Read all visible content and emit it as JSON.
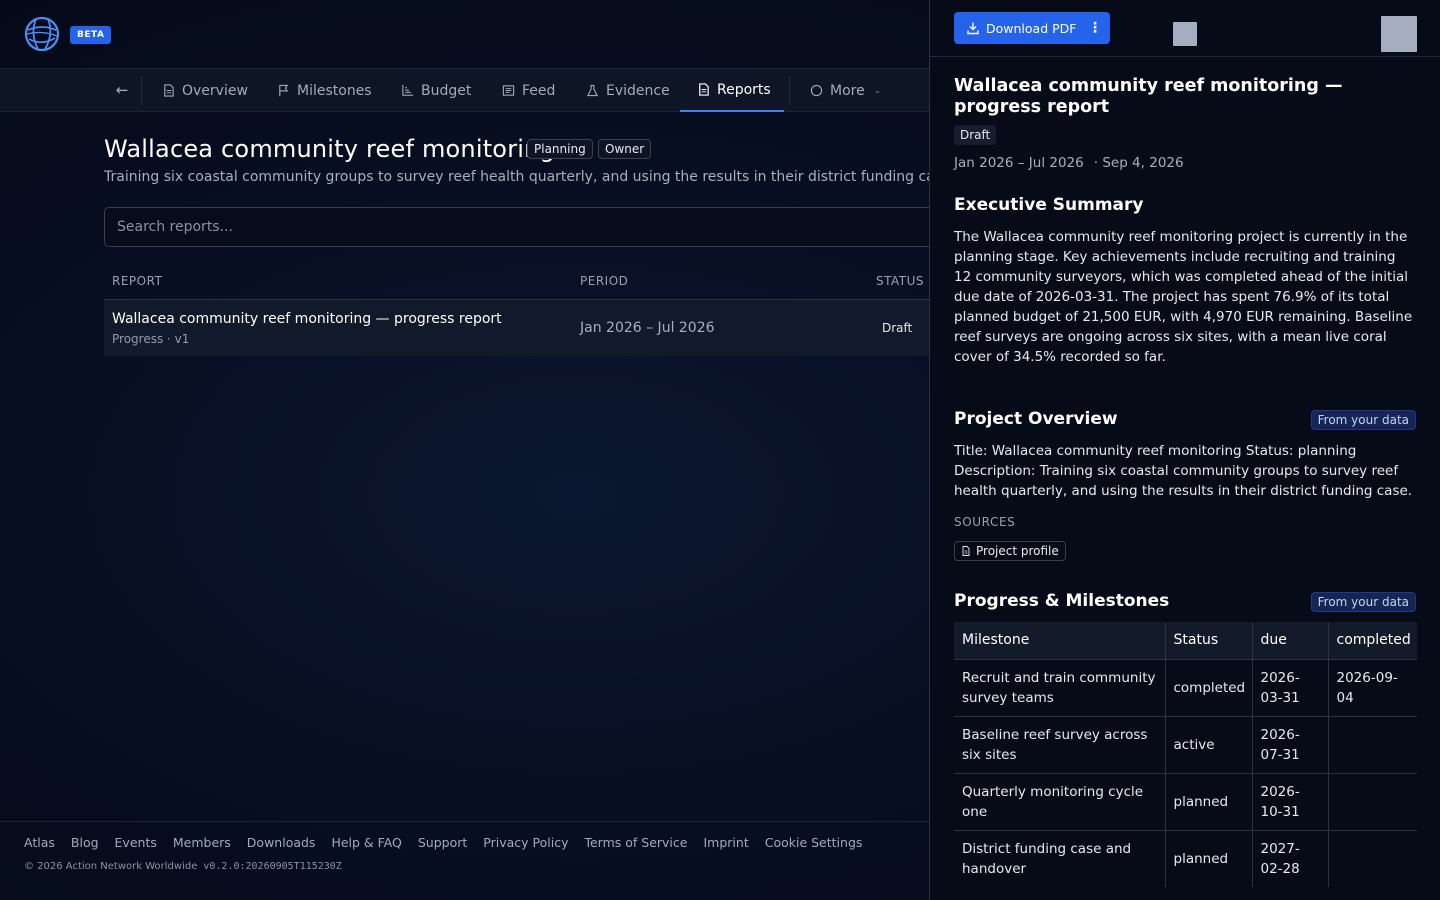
{
  "header": {
    "beta": "BETA"
  },
  "nav": {
    "tabs": [
      {
        "label": "Overview",
        "icon": "doc-icon"
      },
      {
        "label": "Milestones",
        "icon": "flag-icon"
      },
      {
        "label": "Budget",
        "icon": "chart-icon"
      },
      {
        "label": "Feed",
        "icon": "feed-icon"
      },
      {
        "label": "Evidence",
        "icon": "flask-icon"
      },
      {
        "label": "Reports",
        "icon": "report-icon",
        "active": true
      },
      {
        "label": "More",
        "icon": "circle-icon"
      }
    ]
  },
  "project": {
    "title": "Wallacea community reef monitoring",
    "status_chip": "Planning",
    "role_chip": "Owner",
    "description": "Training six coastal community groups to survey reef health quarterly, and using the results in their district funding case."
  },
  "search": {
    "placeholder": "Search reports..."
  },
  "table": {
    "headers": {
      "report": "REPORT",
      "period": "PERIOD",
      "status": "STATUS"
    },
    "rows": [
      {
        "title": "Wallacea community reef monitoring — progress report",
        "sub": "Progress · v1",
        "period": "Jan 2026 – Jul 2026",
        "status": "Draft"
      }
    ]
  },
  "footer": {
    "links": [
      "Atlas",
      "Blog",
      "Events",
      "Members",
      "Downloads",
      "Help & FAQ",
      "Support",
      "Privacy Policy",
      "Terms of Service",
      "Imprint",
      "Cookie Settings"
    ],
    "copyright": "© 2026 Action Network Worldwide",
    "version": "v0.2.0:20260905T115230Z"
  },
  "panel": {
    "download_label": "Download PDF",
    "title": "Wallacea community reef monitoring — progress report",
    "status": "Draft",
    "period": "Jan 2026 – Jul 2026",
    "date": "· Sep 4, 2026",
    "exec": {
      "heading": "Executive Summary",
      "text": "The Wallacea community reef monitoring project is currently in the planning stage. Key achievements include recruiting and training 12 community surveyors, which was completed ahead of the initial due date of 2026-03-31. The project has spent 76.9% of its total planned budget of 21,500 EUR, with 4,970 EUR remaining. Baseline reef surveys are ongoing across six sites, with a mean live coral cover of 34.5% recorded so far."
    },
    "overview": {
      "heading": "Project Overview",
      "badge": "From your data",
      "text": "Title: Wallacea community reef monitoring Status: planning Description: Training six coastal community groups to survey reef health quarterly, and using the results in their district funding case.",
      "sources_label": "SOURCES",
      "source": "Project profile"
    },
    "milestones": {
      "heading": "Progress & Milestones",
      "badge": "From your data",
      "columns": [
        "Milestone",
        "Status",
        "due",
        "completed"
      ],
      "rows": [
        {
          "milestone": "Recruit and train community survey teams",
          "status": "completed",
          "due": "2026-03-31",
          "completed": "2026-09-04"
        },
        {
          "milestone": "Baseline reef survey across six sites",
          "status": "active",
          "due": "2026-07-31",
          "completed": ""
        },
        {
          "milestone": "Quarterly monitoring cycle one",
          "status": "planned",
          "due": "2026-10-31",
          "completed": ""
        },
        {
          "milestone": "District funding case and handover",
          "status": "planned",
          "due": "2027-02-28",
          "completed": ""
        }
      ]
    }
  },
  "colors": {
    "accent": "#2563eb",
    "background": "#050b1a",
    "panel": "#060b18"
  }
}
